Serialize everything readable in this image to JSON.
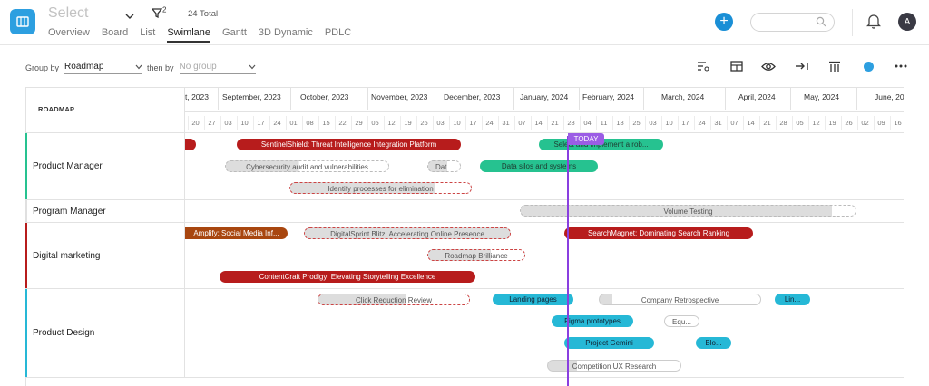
{
  "header": {
    "title": "Select",
    "filter_count": "2",
    "total": "24 Total",
    "tabs": [
      {
        "label": "Overview",
        "active": false
      },
      {
        "label": "Board",
        "active": false
      },
      {
        "label": "List",
        "active": false
      },
      {
        "label": "Swimlane",
        "active": true
      },
      {
        "label": "Gantt",
        "active": false
      },
      {
        "label": "3D Dynamic",
        "active": false
      },
      {
        "label": "PDLC",
        "active": false
      }
    ],
    "avatar_initial": "A",
    "search_placeholder": ""
  },
  "toolbar": {
    "group_by_label": "Group by",
    "group_by_value": "Roadmap",
    "then_by_label": "then by",
    "then_by_value": "No group",
    "accent": "#2d9fe0"
  },
  "timeline": {
    "column_header": "ROADMAP",
    "months": [
      "t, 2023",
      "September, 2023",
      "October, 2023",
      "November, 2023",
      "December, 2023",
      "January, 2024",
      "February, 2024",
      "March, 2024",
      "April, 2024",
      "May, 2024",
      "June, 20"
    ],
    "days": [
      "20",
      "27",
      "03",
      "10",
      "17",
      "24",
      "01",
      "08",
      "15",
      "22",
      "29",
      "05",
      "12",
      "19",
      "26",
      "03",
      "10",
      "17",
      "24",
      "31",
      "07",
      "14",
      "21",
      "28",
      "04",
      "11",
      "18",
      "25",
      "03",
      "10",
      "17",
      "24",
      "31",
      "07",
      "14",
      "21",
      "28",
      "05",
      "12",
      "19",
      "26",
      "02",
      "09",
      "16"
    ],
    "today_label": "TODAY"
  },
  "lanes": [
    {
      "label": "Product Manager",
      "color": "#26c290"
    },
    {
      "label": "Program Manager",
      "color": "#e0e0e0"
    },
    {
      "label": "Digital marketing",
      "color": "#b71c1c"
    },
    {
      "label": "Product Design",
      "color": "#26b8d6"
    }
  ],
  "bars": {
    "pm1": "SentinelShield: Threat Intelligence Integration Platform",
    "pm2": "Select and implement a rob...",
    "pm3": "Cybersecurity audit and vulnerabilities",
    "pm4": "Dat...",
    "pm5": "Data silos and systems",
    "pm6": "Identify processes for elimination",
    "prg1": "Volume Testing",
    "dm1": "Amplify: Social Media Inf...",
    "dm2": "DigitalSprint Blitz: Accelerating Online Presence",
    "dm3": "SearchMagnet: Dominating Search Ranking",
    "dm4": "Roadmap Brilliance",
    "dm5": "ContentCraft Prodigy: Elevating Storytelling Excellence",
    "pd1": "Click Reduction Review",
    "pd2": "Landing pages",
    "pd3": "Company Retrospective",
    "pd4": "Lin...",
    "pd5": "Figma prototypes",
    "pd6": "Equ...",
    "pd7": "Project Gemini",
    "pd8": "Blo...",
    "pd9": "Competition UX Research"
  }
}
